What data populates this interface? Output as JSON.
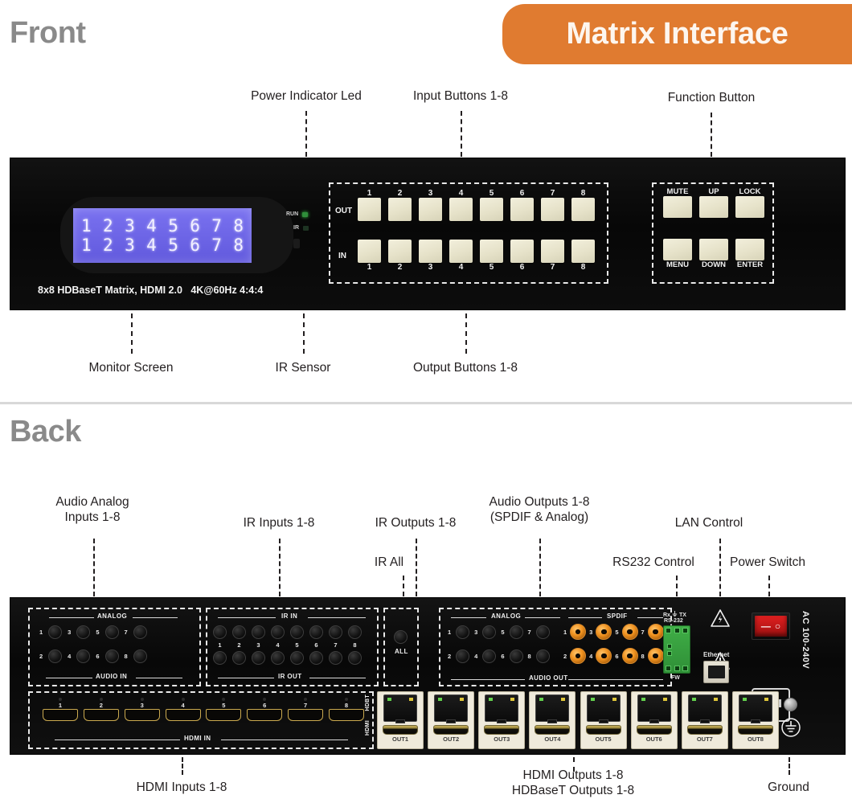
{
  "page": {
    "front_heading": "Front",
    "back_heading": "Back",
    "banner_title": "Matrix Interface",
    "accent_color": "#e07b30",
    "heading_color": "#8a8a8a"
  },
  "front": {
    "callouts_top": [
      {
        "text": "Power Indicator Led"
      },
      {
        "text": "Input Buttons 1-8"
      },
      {
        "text": "Function Button"
      }
    ],
    "callouts_bottom": [
      {
        "text": "Monitor Screen"
      },
      {
        "text": "IR Sensor"
      },
      {
        "text": "Output Buttons 1-8"
      }
    ],
    "lcd": {
      "row1": [
        "1",
        "2",
        "3",
        "4",
        "5",
        "6",
        "7",
        "8"
      ],
      "row2": [
        "1",
        "2",
        "3",
        "4",
        "5",
        "6",
        "7",
        "8"
      ],
      "backlight_color": "#6a62e8"
    },
    "model_text": "8x8 HDBaseT Matrix, HDMI 2.0   4K@60Hz 4:4:4",
    "indicators": [
      {
        "label": "RUN",
        "state": "on",
        "color": "#2f8f3a"
      },
      {
        "label": "IR",
        "state": "off",
        "color": "#1d3322"
      }
    ],
    "out_row": {
      "label": "OUT",
      "numbers": [
        "1",
        "2",
        "3",
        "4",
        "5",
        "6",
        "7",
        "8"
      ]
    },
    "in_row": {
      "label": "IN",
      "numbers": [
        "1",
        "2",
        "3",
        "4",
        "5",
        "6",
        "7",
        "8"
      ]
    },
    "function_buttons_top": [
      "MUTE",
      "UP",
      "LOCK"
    ],
    "function_buttons_bottom": [
      "MENU",
      "DOWN",
      "ENTER"
    ]
  },
  "back": {
    "callouts_top": [
      {
        "text": "Audio Analog\nInputs 1-8"
      },
      {
        "text": "IR Inputs 1-8"
      },
      {
        "text": "IR Outputs 1-8"
      },
      {
        "text": "IR All"
      },
      {
        "text": "Audio Outputs 1-8\n(SPDIF & Analog)"
      },
      {
        "text": "RS232 Control"
      },
      {
        "text": "LAN Control"
      },
      {
        "text": "Power Switch"
      }
    ],
    "callouts_bottom": [
      {
        "text": "HDMI Inputs 1-8"
      },
      {
        "text": "HDMI Outputs 1-8\nHDBaseT Outputs 1-8"
      },
      {
        "text": "Ground"
      }
    ],
    "audio_in": {
      "group_label": "ANALOG",
      "bottom_label": "AUDIO IN",
      "top_numbers": [
        "1",
        "3",
        "5",
        "7"
      ],
      "bottom_numbers": [
        "2",
        "4",
        "6",
        "8"
      ]
    },
    "ir": {
      "in_label": "IR IN",
      "out_label": "IR OUT",
      "numbers": [
        "1",
        "2",
        "3",
        "4",
        "5",
        "6",
        "7",
        "8"
      ],
      "all_label": "ALL"
    },
    "audio_out": {
      "analog_label": "ANALOG",
      "spdif_label": "SPDIF",
      "bottom_label": "AUDIO OUT",
      "analog_top_numbers": [
        "1",
        "3",
        "5",
        "7"
      ],
      "analog_bottom_numbers": [
        "2",
        "4",
        "6",
        "8"
      ],
      "spdif_top_numbers": [
        "1",
        "3",
        "5",
        "7"
      ],
      "spdif_bottom_numbers": [
        "2",
        "4",
        "6",
        "8"
      ]
    },
    "hdmi_in": {
      "label": "HDMI IN",
      "numbers": [
        "1",
        "2",
        "3",
        "4",
        "5",
        "6",
        "7",
        "8"
      ]
    },
    "outputs": {
      "hdbt_label": "HDBT",
      "hdmi_label": "HDMI",
      "captions": [
        "OUT1",
        "OUT2",
        "OUT3",
        "OUT4",
        "OUT5",
        "OUT6",
        "OUT7",
        "OUT8"
      ]
    },
    "rs232": {
      "pin_label": "Rx      TX",
      "name_label": "RS-232",
      "fw_label": "FW"
    },
    "ethernet": {
      "label": "Ethernet"
    },
    "power": {
      "voltage_label": "AC 100-240V",
      "switch_on": "—",
      "switch_off": "○"
    }
  }
}
